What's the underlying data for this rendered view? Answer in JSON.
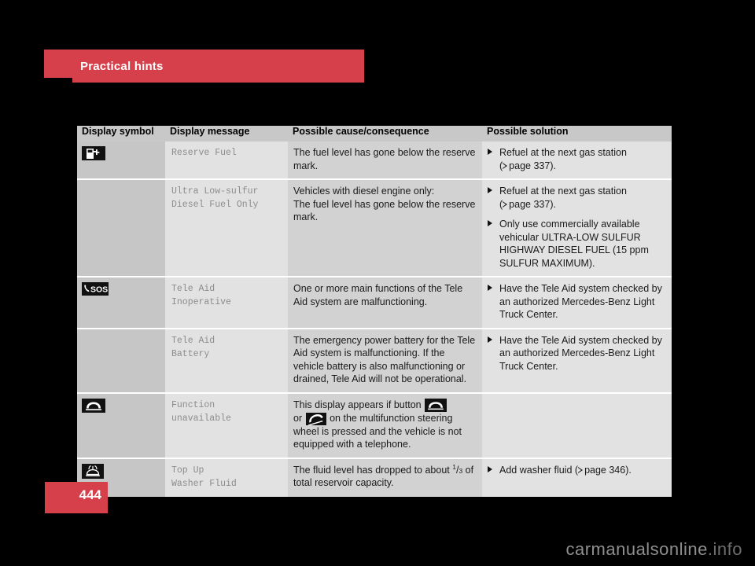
{
  "header": {
    "title": "Practical hints",
    "band_color": "#d6404a"
  },
  "page_number": "444",
  "watermark": {
    "text_main": "carmanualsonline",
    "text_suffix": ".info"
  },
  "table": {
    "columns": [
      "Display symbol",
      "Display message",
      "Possible cause/consequence",
      "Possible solution"
    ],
    "rows": [
      {
        "symbol_icon": "fuel-pump-icon",
        "message": "Reserve Fuel",
        "cause": "The fuel level has gone below the reserve mark.",
        "solutions": [
          {
            "text_before": "Refuel at the next gas station",
            "ref_prefix": "(",
            "ref_text": "page 337",
            "ref_suffix": ")."
          }
        ]
      },
      {
        "symbol_icon": "",
        "message": "Ultra Low-sulfur\nDiesel Fuel Only",
        "cause": "Vehicles with diesel engine only:\nThe fuel level has gone below the reserve mark.",
        "solutions": [
          {
            "text_before": "Refuel at the next gas station",
            "ref_prefix": "(",
            "ref_text": "page 337",
            "ref_suffix": ")."
          },
          {
            "text_before": "Only use commercially available vehicular ULTRA-LOW SULFUR HIGHWAY DIESEL FUEL (15 ppm SULFUR MAXIMUM).",
            "ref_prefix": "",
            "ref_text": "",
            "ref_suffix": ""
          }
        ]
      },
      {
        "symbol_icon": "sos-phone-icon",
        "message": "Tele Aid\nInoperative",
        "cause": "One or more main functions of the Tele Aid system are malfunctioning.",
        "solutions": [
          {
            "text_before": "Have the Tele Aid system checked by an authorized Mercedes-Benz Light Truck Center.",
            "ref_prefix": "",
            "ref_text": "",
            "ref_suffix": ""
          }
        ]
      },
      {
        "symbol_icon": "",
        "message": "Tele Aid\nBattery",
        "cause": "The emergency power battery for the Tele Aid system is malfunctioning. If the vehicle battery is also malfunctioning or drained, Tele Aid will not be operational.",
        "solutions": [
          {
            "text_before": "Have the Tele Aid system checked by an authorized Mercedes-Benz Light Truck Center.",
            "ref_prefix": "",
            "ref_text": "",
            "ref_suffix": ""
          }
        ]
      },
      {
        "symbol_icon": "phone-hangup-icon",
        "message": "Function\nunavailable",
        "cause_part1": "This display appears if button",
        "cause_icon1": "phone-hangup-icon",
        "cause_part2": "or",
        "cause_icon2": "phone-pickup-icon",
        "cause_part3": "on the multifunction steering wheel is pressed and the vehicle is not equipped with a telephone.",
        "solutions": []
      },
      {
        "symbol_icon": "washer-fluid-icon",
        "message": "Top Up\nWasher Fluid",
        "cause_part1": "The fluid level has dropped to about",
        "fraction_numerator": "1",
        "fraction_denominator": "3",
        "cause_part3": "of total reservoir capacity.",
        "solutions": [
          {
            "text_before": "Add washer fluid",
            "ref_prefix": "(",
            "ref_text": "page 346",
            "ref_suffix": ")."
          }
        ]
      }
    ]
  }
}
